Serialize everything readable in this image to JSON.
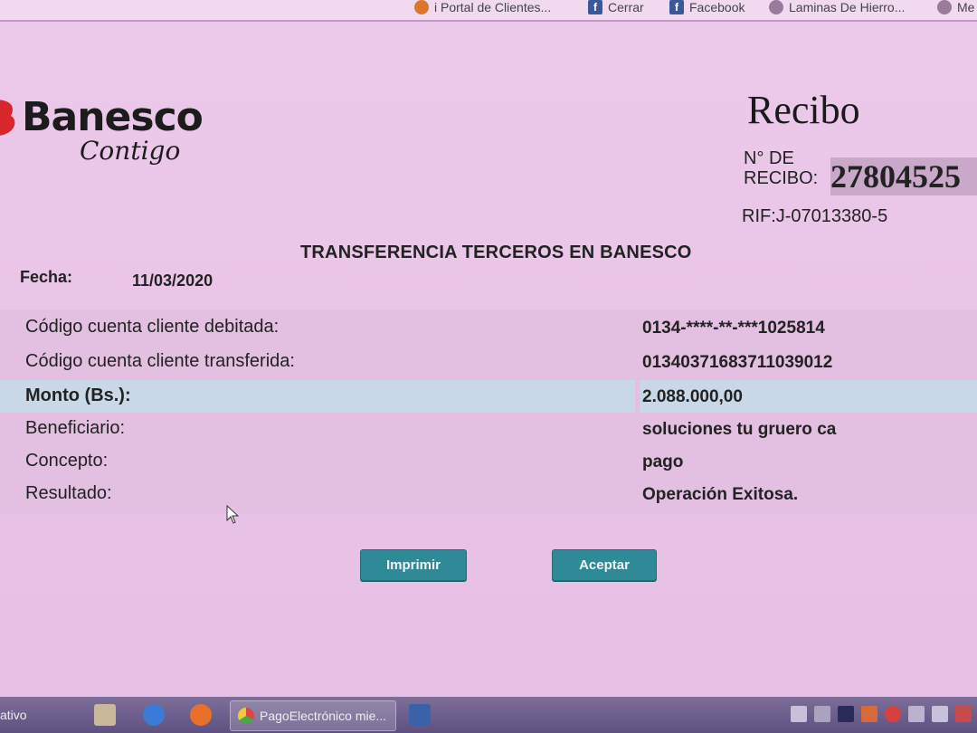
{
  "bookmarks": [
    {
      "label": "i Portal de Clientes...",
      "icon": "portal-icon"
    },
    {
      "label": "Cerrar",
      "icon": "facebook-icon"
    },
    {
      "label": "Facebook",
      "icon": "facebook-icon"
    },
    {
      "label": "Laminas De Hierro...",
      "icon": "web-icon"
    },
    {
      "label": "Me",
      "icon": "web-icon"
    }
  ],
  "brand": {
    "name": "Banesco",
    "tagline": "Contigo"
  },
  "receipt": {
    "title": "Recibo",
    "number_label_line1": "N° DE",
    "number_label_line2": "RECIBO:",
    "number": "27804525",
    "rif": "RIF:J-07013380-5"
  },
  "transfer": {
    "title": "TRANSFERENCIA TERCEROS EN BANESCO",
    "date_label": "Fecha:",
    "date": "11/03/2020",
    "rows": [
      {
        "label": "Código cuenta cliente debitada:",
        "value": "0134-****-**-***1025814"
      },
      {
        "label": "Código cuenta cliente transferida:",
        "value": "01340371683711039012"
      },
      {
        "label": "Monto (Bs.):",
        "value": "2.088.000,00"
      },
      {
        "label": "Beneficiario:",
        "value": "soluciones tu gruero ca"
      },
      {
        "label": "Concepto:",
        "value": "pago"
      },
      {
        "label": "Resultado:",
        "value": "Operación Exitosa."
      }
    ]
  },
  "actions": {
    "print": "Imprimir",
    "accept": "Aceptar"
  },
  "taskbar": {
    "left_text": "ativo",
    "active_task": "PagoElectrónico mie..."
  },
  "colors": {
    "button": "#2f8a98",
    "highlight_row": "#c9d8e6",
    "brand_red": "#d8262d"
  }
}
